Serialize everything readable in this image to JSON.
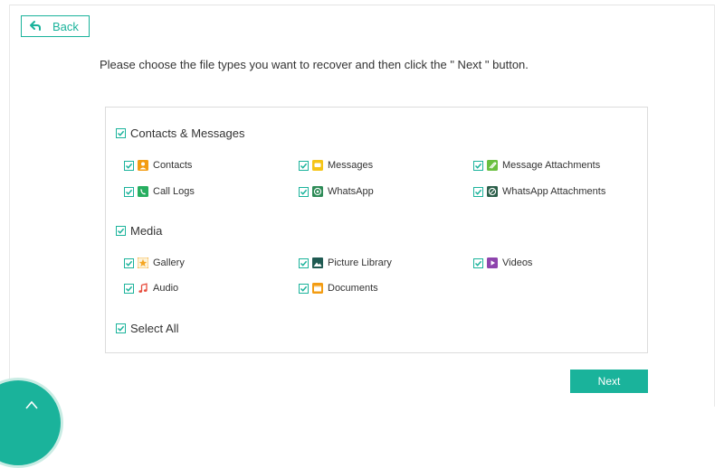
{
  "header": {
    "back_label": "Back"
  },
  "instruction": "Please choose the file types you want to recover and then click the \" Next \" button.",
  "categories": [
    {
      "label": "Contacts & Messages",
      "items": [
        {
          "label": "Contacts",
          "icon": "contacts-icon",
          "color": "#f39c12"
        },
        {
          "label": "Messages",
          "icon": "messages-icon",
          "color": "#f5c518"
        },
        {
          "label": "Message Attachments",
          "icon": "message-attachments-icon",
          "color": "#6abf40"
        },
        {
          "label": "Call Logs",
          "icon": "call-logs-icon",
          "color": "#27ae60"
        },
        {
          "label": "WhatsApp",
          "icon": "whatsapp-icon",
          "color": "#2e8b57"
        },
        {
          "label": "WhatsApp Attachments",
          "icon": "whatsapp-attachments-icon",
          "color": "#2c5f4a"
        }
      ]
    },
    {
      "label": "Media",
      "items": [
        {
          "label": "Gallery",
          "icon": "gallery-icon",
          "color": "#f5a623"
        },
        {
          "label": "Picture Library",
          "icon": "picture-library-icon",
          "color": "#1f5a52"
        },
        {
          "label": "Videos",
          "icon": "videos-icon",
          "color": "#8e44ad"
        },
        {
          "label": "Audio",
          "icon": "audio-icon",
          "color": "#e74c3c"
        },
        {
          "label": "Documents",
          "icon": "documents-icon",
          "color": "#f39c12"
        }
      ]
    }
  ],
  "select_all_label": "Select All",
  "next_label": "Next",
  "colors": {
    "accent": "#1ab39b",
    "border": "#dcdcdc",
    "text": "#333333"
  }
}
